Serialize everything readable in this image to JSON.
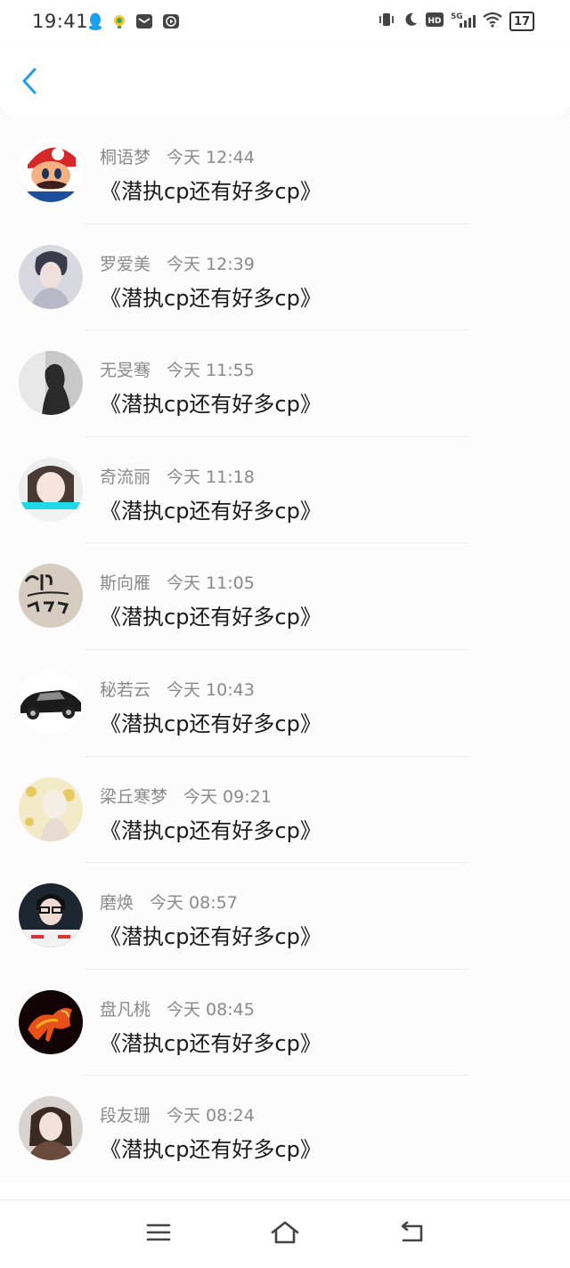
{
  "status_bar": {
    "time": "19:41",
    "left_icons": [
      "qq-icon",
      "app-icon",
      "mail-icon",
      "media-icon"
    ],
    "right_icons": [
      "vibrate-icon",
      "moon-icon",
      "hd-icon",
      "signal-5g-icon",
      "wifi-icon"
    ],
    "battery": "17"
  },
  "header": {
    "back_icon": "chevron-left-icon",
    "accent_color": "#1e9bf0"
  },
  "messages": [
    {
      "name": "桐语梦",
      "time": "今天 12:44",
      "text": "《潜执cp还有好多cp》"
    },
    {
      "name": "罗爱美",
      "time": "今天 12:39",
      "text": "《潜执cp还有好多cp》"
    },
    {
      "name": "无旻骞",
      "time": "今天 11:55",
      "text": "《潜执cp还有好多cp》"
    },
    {
      "name": "奇流丽",
      "time": "今天 11:18",
      "text": "《潜执cp还有好多cp》"
    },
    {
      "name": "斯向雁",
      "time": "今天 11:05",
      "text": "《潜执cp还有好多cp》"
    },
    {
      "name": "秘若云",
      "time": "今天 10:43",
      "text": "《潜执cp还有好多cp》"
    },
    {
      "name": "梁丘寒梦",
      "time": "今天 09:21",
      "text": "《潜执cp还有好多cp》"
    },
    {
      "name": "磨焕",
      "time": "今天 08:57",
      "text": "《潜执cp还有好多cp》"
    },
    {
      "name": "盘凡桃",
      "time": "今天 08:45",
      "text": "《潜执cp还有好多cp》"
    },
    {
      "name": "段友珊",
      "time": "今天 08:24",
      "text": "《潜执cp还有好多cp》"
    }
  ],
  "nav": {
    "icons": [
      "menu-icon",
      "home-icon",
      "back-icon"
    ]
  }
}
